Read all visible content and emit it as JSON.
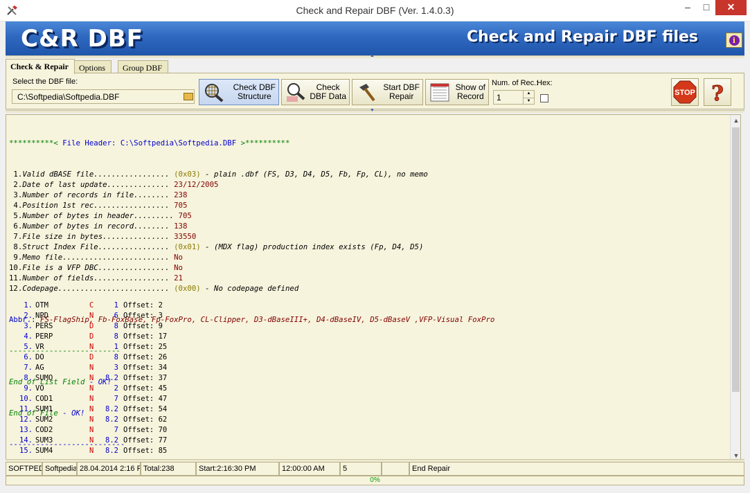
{
  "window": {
    "title": "Check and Repair DBF  (Ver. 1.4.0.3)"
  },
  "banner": {
    "brand": "C&R DBF",
    "tagline": "Check and Repair DBF files"
  },
  "tabs": [
    {
      "label": "Check & Repair",
      "active": true
    },
    {
      "label": "Options",
      "active": false
    },
    {
      "label": "Group DBF",
      "active": false
    }
  ],
  "toolbar": {
    "file_label": "Select the DBF file:",
    "file_value": "C:\\Softpedia\\Softpedia.DBF",
    "buttons": [
      {
        "label1": "Check DBF",
        "label2": "Structure",
        "icon": "magnifier-grid-icon"
      },
      {
        "label1": "Check",
        "label2": "DBF Data",
        "icon": "magnifier-data-icon"
      },
      {
        "label1": "Start DBF",
        "label2": "Repair",
        "icon": "hammer-icon"
      },
      {
        "label1": "Show of",
        "label2": "Record",
        "icon": "record-icon"
      }
    ],
    "num_label": "Num. of Rec.:",
    "hex_label": "Hex:",
    "num_value": "1",
    "stop_label": "STOP"
  },
  "log": {
    "header": {
      "stars": "**********<",
      "label": "File Header:",
      "file": "C:\\Softpedia\\Softpedia.DBF",
      "end": ">**********"
    },
    "lines": [
      {
        "num": " 1.",
        "label": "Valid dBASE file.................",
        "value": "(0x03)",
        "rest": " - plain .dbf (FS, D3, D4, D5, Fb, Fp, CL), no memo",
        "hexstyle": true
      },
      {
        "num": " 2.",
        "label": "Date of last update..............",
        "value": "23/12/2005",
        "rest": ""
      },
      {
        "num": " 3.",
        "label": "Number of records in file........",
        "value": "238",
        "rest": ""
      },
      {
        "num": " 4.",
        "label": "Position 1st rec.................",
        "value": "705",
        "rest": ""
      },
      {
        "num": " 5.",
        "label": "Number of bytes in header.........",
        "value": "705",
        "rest": ""
      },
      {
        "num": " 6.",
        "label": "Number of bytes in record........",
        "value": "138",
        "rest": ""
      },
      {
        "num": " 7.",
        "label": "File size in bytes...............",
        "value": "33550",
        "rest": ""
      },
      {
        "num": " 8.",
        "label": "Struct Index File................",
        "value": "(0x01)",
        "rest": " - (MDX flag) production index exists (Fp, D4, D5)",
        "hexstyle": true
      },
      {
        "num": " 9.",
        "label": "Memo file........................",
        "value": "No",
        "rest": ""
      },
      {
        "num": "10.",
        "label": "File is a VFP DBC................",
        "value": "No",
        "rest": ""
      },
      {
        "num": "11.",
        "label": "Number of fields.................",
        "value": "21",
        "rest": ""
      },
      {
        "num": "12.",
        "label": "Codepage.........................",
        "value": "(0x00)",
        "rest": " - No codepage defined",
        "hexstyle": true
      }
    ],
    "abbr_label": "Abbr.:",
    "abbr_text": " FS-FlagShip, Fb-FoxBase, Fp-FoxPro, CL-Clipper, D3-dBaseIII+, D4-dBaseIV, D5-dBaseV ,VFP-Visual FoxPro",
    "separator": "-------------------------",
    "end_list_label": "End of List Field",
    "end_list_ok": " - OK!",
    "end_file_label": "End of File",
    "end_file_ok": " - OK!",
    "separator2": "--------------------------",
    "fields": [
      {
        "n": "1.",
        "name": "OTM",
        "type": "C",
        "len": "1",
        "offset": "Offset: 2"
      },
      {
        "n": "2.",
        "name": "NPD",
        "type": "N",
        "len": "6",
        "offset": "Offset: 3"
      },
      {
        "n": "3.",
        "name": "PERS",
        "type": "D",
        "len": "8",
        "offset": "Offset: 9"
      },
      {
        "n": "4.",
        "name": "PERP",
        "type": "D",
        "len": "8",
        "offset": "Offset: 17"
      },
      {
        "n": "5.",
        "name": "VR",
        "type": "N",
        "len": "1",
        "offset": "Offset: 25"
      },
      {
        "n": "6.",
        "name": "DO",
        "type": "D",
        "len": "8",
        "offset": "Offset: 26"
      },
      {
        "n": "7.",
        "name": "AG",
        "type": "N",
        "len": "3",
        "offset": "Offset: 34"
      },
      {
        "n": "8.",
        "name": "SUMO",
        "type": "N",
        "len": "8.2",
        "offset": "Offset: 37"
      },
      {
        "n": "9.",
        "name": "VO",
        "type": "N",
        "len": "2",
        "offset": "Offset: 45"
      },
      {
        "n": "10.",
        "name": "COD1",
        "type": "N",
        "len": "7",
        "offset": "Offset: 47"
      },
      {
        "n": "11.",
        "name": "SUM1",
        "type": "N",
        "len": "8.2",
        "offset": "Offset: 54"
      },
      {
        "n": "12.",
        "name": "SUM2",
        "type": "N",
        "len": "8.2",
        "offset": "Offset: 62"
      },
      {
        "n": "13.",
        "name": "COD2",
        "type": "N",
        "len": "7",
        "offset": "Offset: 70"
      },
      {
        "n": "14.",
        "name": "SUM3",
        "type": "N",
        "len": "8.2",
        "offset": "Offset: 77"
      },
      {
        "n": "15.",
        "name": "SUM4",
        "type": "N",
        "len": "8.2",
        "offset": "Offset: 85"
      }
    ]
  },
  "status": {
    "panels": [
      "SOFTPED",
      "Softpedia",
      "28.04.2014 2:16 F",
      "Total:238",
      "Start:2:16:30 PM",
      "12:00:00 AM",
      "5",
      "",
      "End Repair"
    ],
    "progress_text": "0%",
    "progress_value": 0
  }
}
